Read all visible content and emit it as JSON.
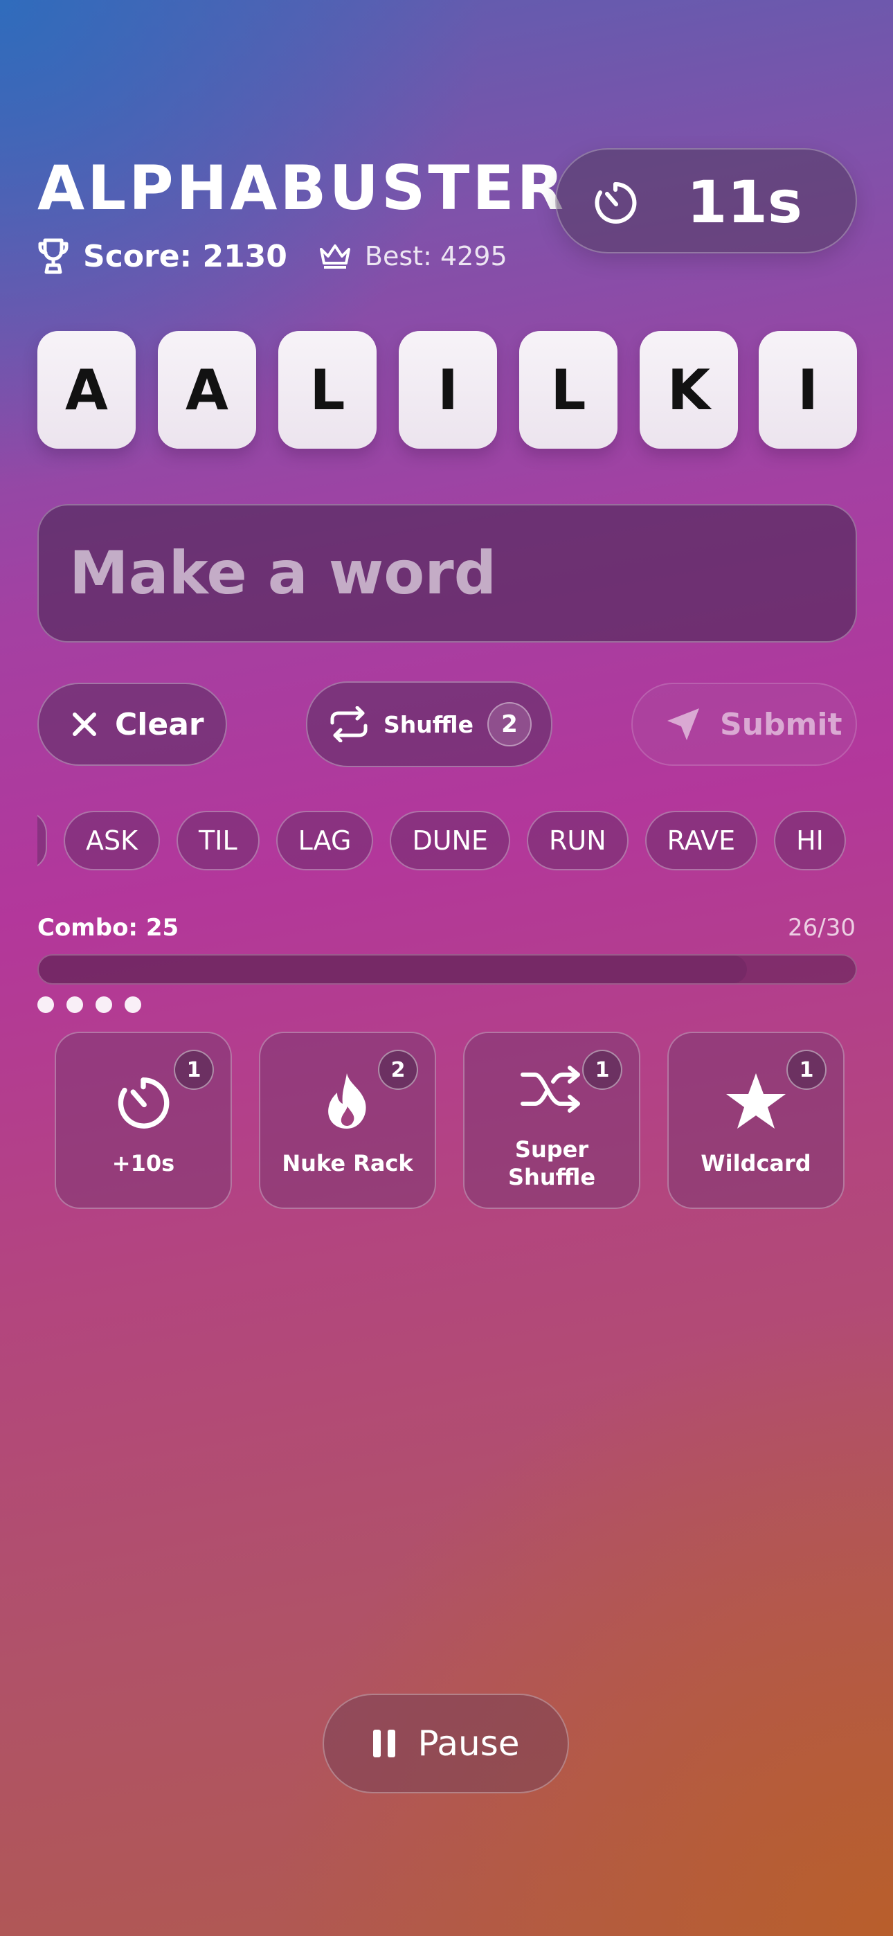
{
  "header": {
    "title": "ALPHABUSTER",
    "score": "Score: 2130",
    "best": "Best: 4295",
    "timer": "11s"
  },
  "tiles": [
    "A",
    "A",
    "L",
    "I",
    "L",
    "K",
    "I"
  ],
  "input": {
    "placeholder": "Make a word",
    "value": ""
  },
  "actions": {
    "clear_label": "Clear",
    "shuffle_label": "Shuffle",
    "shuffle_count": "2",
    "submit_label": "Submit"
  },
  "found_words": [
    "",
    "ASK",
    "TIL",
    "LAG",
    "DUNE",
    "RUN",
    "RAVE",
    "HI"
  ],
  "combo": {
    "label": "Combo: 25",
    "progress": "26/30",
    "fraction": 0.867,
    "dots": 4
  },
  "powerups": [
    {
      "label": "+10s",
      "count": "1",
      "icon": "stopwatch-icon"
    },
    {
      "label": "Nuke Rack",
      "count": "2",
      "icon": "flame-icon"
    },
    {
      "label": "Super Shuffle",
      "count": "1",
      "icon": "shuffle-icon"
    },
    {
      "label": "Wildcard",
      "count": "1",
      "icon": "star-icon"
    }
  ],
  "pause_label": "Pause",
  "colors": {
    "tile": "#f2edf3",
    "tile_text": "#121212",
    "text": "#ffffff"
  }
}
